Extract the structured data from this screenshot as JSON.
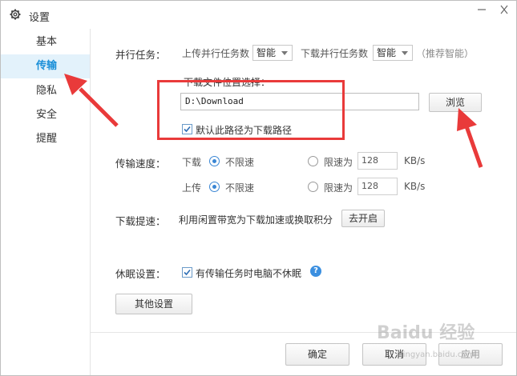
{
  "window": {
    "title": "设置"
  },
  "sidebar": {
    "items": [
      {
        "label": "基本",
        "active": false
      },
      {
        "label": "传输",
        "active": true
      },
      {
        "label": "隐私",
        "active": false
      },
      {
        "label": "安全",
        "active": false
      },
      {
        "label": "提醒",
        "active": false
      }
    ]
  },
  "parallel": {
    "label": "并行任务：",
    "upload_label": "上传并行任务数",
    "upload_value": "智能",
    "download_label": "下载并行任务数",
    "download_value": "智能",
    "hint": "（推荐智能）"
  },
  "download_path": {
    "label": "下载文件位置选择：",
    "value": "D:\\Download",
    "browse_label": "浏览",
    "default_checkbox_label": "默认此路径为下载路径",
    "default_checked": true
  },
  "speed": {
    "label": "传输速度：",
    "download": {
      "label": "下载",
      "unlimited": "不限速",
      "limit": "限速为",
      "value": "128",
      "unit": "KB/s"
    },
    "upload": {
      "label": "上传",
      "unlimited": "不限速",
      "limit": "限速为",
      "value": "128",
      "unit": "KB/s"
    }
  },
  "boost": {
    "label": "下载提速：",
    "text": "利用闲置带宽为下载加速或换取积分",
    "button": "去开启"
  },
  "sleep": {
    "label": "休眠设置：",
    "checkbox_label": "有传输任务时电脑不休眠",
    "checked": true,
    "help": "?"
  },
  "other_settings_label": "其他设置",
  "footer": {
    "ok": "确定",
    "cancel": "取消",
    "apply": "应用"
  },
  "watermark": {
    "text": "Baidu 经验",
    "sub": "jingyan.baidu.com"
  },
  "colors": {
    "accent": "#1a8fd8",
    "active_bg": "#e3f2fb",
    "annotation": "#e93a3a"
  }
}
